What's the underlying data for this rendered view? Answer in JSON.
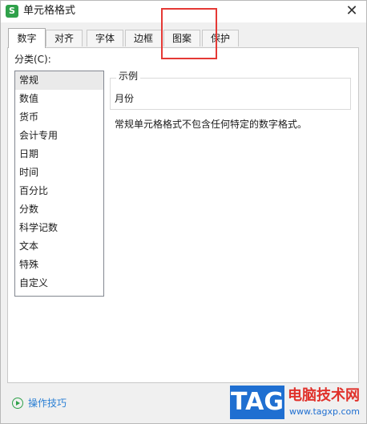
{
  "window": {
    "title": "单元格格式",
    "app_icon_glyph": "S"
  },
  "tabs": [
    {
      "label": "数字",
      "active": true
    },
    {
      "label": "对齐"
    },
    {
      "label": "字体"
    },
    {
      "label": "边框"
    },
    {
      "label": "图案"
    },
    {
      "label": "保护"
    }
  ],
  "category": {
    "label": "分类(C):",
    "items": [
      "常规",
      "数值",
      "货币",
      "会计专用",
      "日期",
      "时间",
      "百分比",
      "分数",
      "科学记数",
      "文本",
      "特殊",
      "自定义"
    ],
    "selected_index": 0
  },
  "sample": {
    "legend": "示例",
    "value": "月份"
  },
  "description": "常规单元格格式不包含任何特定的数字格式。",
  "footer": {
    "tips_label": "操作技巧"
  },
  "watermark": {
    "tag": "TAG",
    "site": "电脑技术网",
    "url": "www.tagxp.com"
  },
  "colors": {
    "highlight": "#e53935",
    "accent": "#2fa14a",
    "link": "#2a7fd4"
  }
}
